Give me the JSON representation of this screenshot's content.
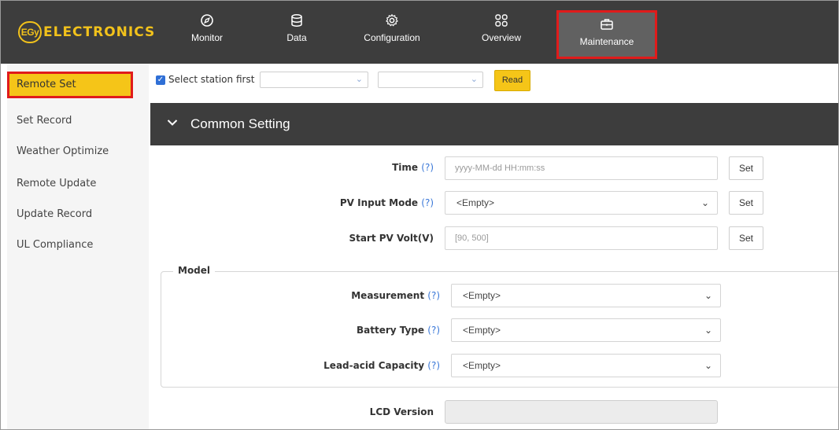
{
  "brand": {
    "badge": "EGy",
    "name": "ELECTRONICS"
  },
  "nav": {
    "monitor": "Monitor",
    "data": "Data",
    "configuration": "Configuration",
    "overview": "Overview",
    "maintenance": "Maintenance"
  },
  "sidebar": {
    "items": [
      "Remote Set",
      "Set Record",
      "Weather Optimize",
      "Remote Update",
      "Update Record",
      "UL Compliance"
    ],
    "active": "Remote Set"
  },
  "toolbar": {
    "checkbox_label": "Select station first",
    "checkbox_checked": true,
    "select1_value": "",
    "select2_value": "",
    "read_label": "Read"
  },
  "section": {
    "title": "Common Setting"
  },
  "form": {
    "help": "(?)",
    "time_label": "Time",
    "time_placeholder": "yyyy-MM-dd HH:mm:ss",
    "pv_mode_label": "PV Input Mode",
    "pv_mode_value": "<Empty>",
    "start_pv_label": "Start PV Volt(V)",
    "start_pv_placeholder": "[90, 500]",
    "set_label": "Set"
  },
  "model": {
    "legend": "Model",
    "measurement_label": "Measurement",
    "measurement_value": "<Empty>",
    "battery_type_label": "Battery Type",
    "battery_type_value": "<Empty>",
    "lead_acid_label": "Lead-acid Capacity",
    "lead_acid_value": "<Empty>"
  },
  "lcd": {
    "label": "LCD Version",
    "value": ""
  },
  "colors": {
    "accent": "#f5c518",
    "header": "#3d3d3d",
    "highlight": "#e01b1b",
    "help": "#3a78d8"
  }
}
